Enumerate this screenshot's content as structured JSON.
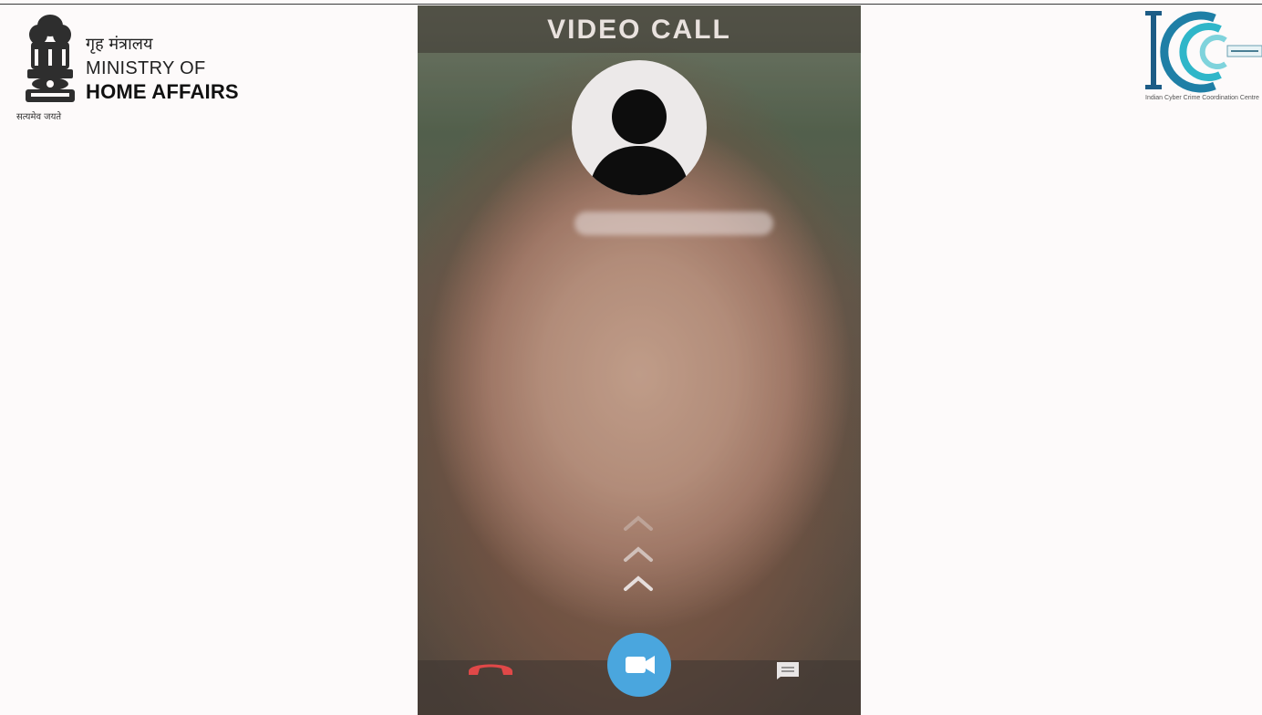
{
  "ministry": {
    "hindi_name": "गृह मंत्रालय",
    "line1": "MINISTRY OF",
    "line2": "HOME AFFAIRS",
    "motto": "सत्यमेव जयते"
  },
  "i4c": {
    "caption": "Indian Cyber Crime Coordination Centre"
  },
  "call": {
    "title": "VIDEO CALL"
  },
  "colors": {
    "accept_video": "#4aa6de",
    "hangup": "#e04848",
    "title_text": "#e9e2de"
  },
  "icons": {
    "avatar": "person-silhouette-icon",
    "hangup": "phone-hangup-icon",
    "video": "video-camera-icon",
    "message": "message-icon",
    "swipe": "chevron-up-icon"
  }
}
